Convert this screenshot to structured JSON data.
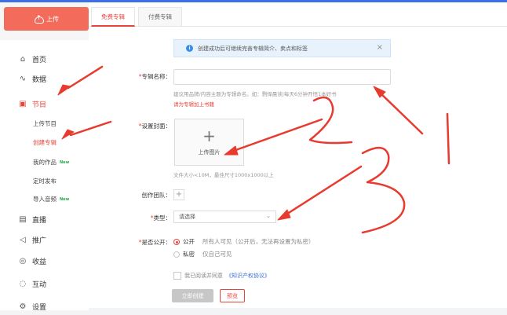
{
  "sidebar": {
    "upload_label": "上传",
    "items": [
      {
        "label": "首页",
        "icon": "home-icon"
      },
      {
        "label": "数据",
        "icon": "chart-icon"
      },
      {
        "label": "节目",
        "icon": "program-icon"
      },
      {
        "label": "直播",
        "icon": "live-icon"
      },
      {
        "label": "推广",
        "icon": "promote-icon"
      },
      {
        "label": "收益",
        "icon": "income-icon"
      },
      {
        "label": "互动",
        "icon": "chat-icon"
      },
      {
        "label": "设置",
        "icon": "settings-icon"
      }
    ],
    "sub_items": [
      {
        "label": "上传节目",
        "badge": ""
      },
      {
        "label": "创建专辑",
        "badge": ""
      },
      {
        "label": "我的作品",
        "badge": "New"
      },
      {
        "label": "定时发布",
        "badge": ""
      },
      {
        "label": "导入音频",
        "badge": "New"
      }
    ]
  },
  "tabs": [
    {
      "label": "免费专辑"
    },
    {
      "label": "付费专辑"
    }
  ],
  "notice": {
    "text": "创建成功后可继续完善专辑简介、卖点和标签",
    "close": "×"
  },
  "form": {
    "name": {
      "label": "专辑名称：",
      "value": "",
      "hint": "建议用品牌/内容主题为专辑命名。如：剽悍晨读|每天6分钟开悟1本好书",
      "link": "请为专辑加上书籍"
    },
    "cover": {
      "label": "设置封面：",
      "button": "上传图片",
      "plus": "+",
      "hint": "文件大小<10M，最佳尺寸1000x1000以上"
    },
    "team": {
      "label": "创作团队：",
      "plus": "+"
    },
    "type": {
      "label": "类型：",
      "value": "请选择",
      "chevron": "⌄"
    },
    "public": {
      "label": "是否公开：",
      "options": [
        {
          "label": "公开",
          "desc": "所有人可见（公开后，无法再设置为私密）",
          "selected": true
        },
        {
          "label": "私密",
          "desc": "仅自己可见",
          "selected": false
        }
      ]
    },
    "agree": {
      "prefix": "我已阅读并同意",
      "link": "《知识产权协议》"
    },
    "create_button": "立即创建",
    "preview_button": "预览"
  }
}
